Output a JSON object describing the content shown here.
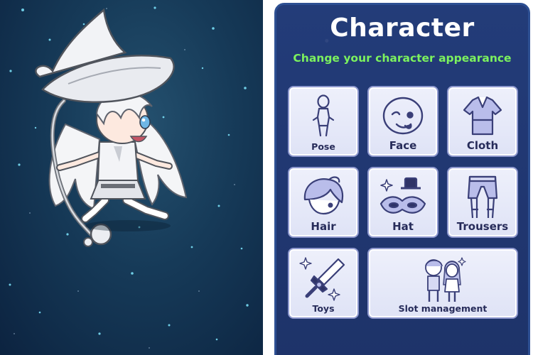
{
  "panel": {
    "title": "Character",
    "subtitle": "Change your character appearance"
  },
  "menu": {
    "items": [
      {
        "label": "Pose"
      },
      {
        "label": "Face"
      },
      {
        "label": "Cloth"
      },
      {
        "label": "Hair"
      },
      {
        "label": "Hat"
      },
      {
        "label": "Trousers"
      },
      {
        "label": "Toys"
      },
      {
        "label": "Slot management"
      }
    ]
  },
  "colors": {
    "panel_background": "#223a77",
    "title": "#ffffff",
    "subtitle": "#7cf25e",
    "tile_background": "#e6e9f8",
    "tile_border": "#8f99cf",
    "tile_text": "#272c5a",
    "scene_background": "#163a58"
  },
  "icons": {
    "pose": "body-silhouette-icon",
    "face": "face-icon",
    "cloth": "shirt-icon",
    "hair": "hair-icon",
    "hat": "top-hat-mask-icon",
    "trousers": "trousers-icon",
    "toys": "sword-icon",
    "slot": "character-pair-icon"
  }
}
